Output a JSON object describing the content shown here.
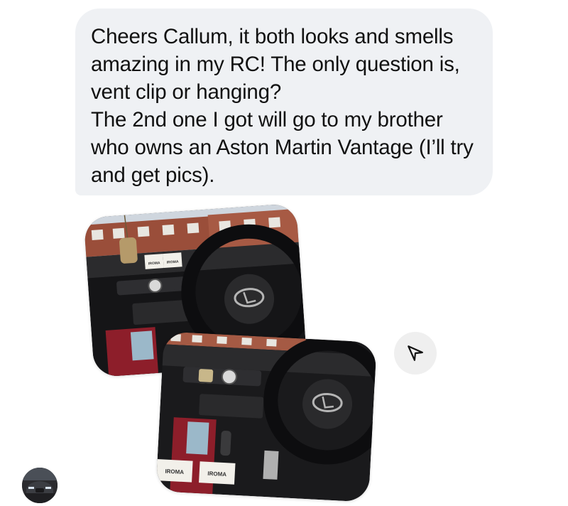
{
  "message": {
    "lines": [
      "Cheers Callum, it both looks and smells amazing in my RC! The only question is, vent clip or hanging?",
      "The 2nd one I got will go to my brother who owns an Aston Martin Vantage (I’ll try and get pics)."
    ]
  },
  "photos": [
    {
      "product_labels": [
        "IROMA",
        "IROMA"
      ]
    },
    {
      "product_labels": [
        "IROMA",
        "IROMA"
      ]
    }
  ],
  "icons": {
    "share": "paper-plane-icon",
    "avatar": "profile-avatar"
  },
  "colors": {
    "bubble_bg": "#eff1f4",
    "text": "#111111",
    "share_bg": "#efefef"
  }
}
